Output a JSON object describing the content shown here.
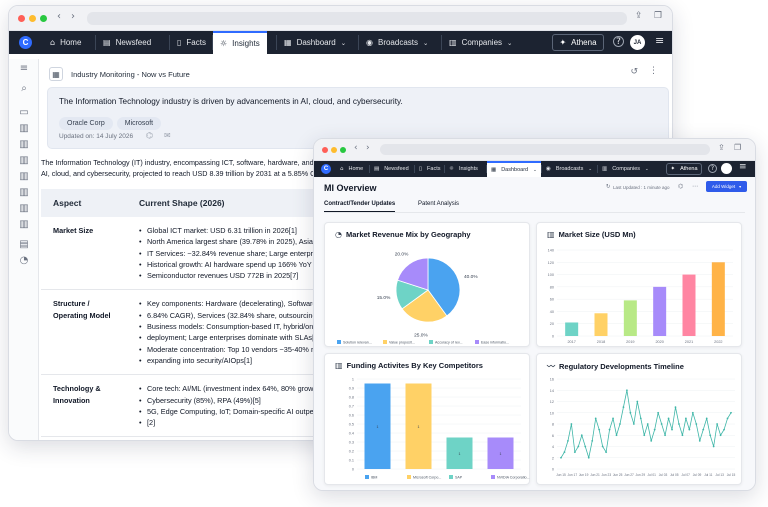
{
  "back_window": {
    "nav": {
      "logo": "C",
      "items": [
        {
          "label": "Home",
          "icon": "home-icon",
          "glyph": "⌂"
        },
        {
          "label": "Newsfeed",
          "icon": "newsfeed-icon",
          "glyph": "▤"
        },
        {
          "label": "Facts",
          "icon": "facts-icon",
          "glyph": "▯"
        },
        {
          "label": "Insights",
          "icon": "lightbulb-icon",
          "glyph": "☼",
          "active": true
        },
        {
          "label": "Dashboard",
          "icon": "dashboard-icon",
          "glyph": "▦",
          "dropdown": true
        },
        {
          "label": "Broadcasts",
          "icon": "broadcast-icon",
          "glyph": "◉",
          "dropdown": true
        },
        {
          "label": "Companies",
          "icon": "companies-icon",
          "glyph": "▥",
          "dropdown": true
        }
      ],
      "athena": "Athena",
      "avatar": "JA"
    },
    "page": {
      "title": "Industry Monitoring - Now vs Future",
      "headline": "The Information Technology industry is driven by advancements in AI, cloud, and cybersecurity.",
      "chips": [
        "Oracle Corp",
        "Microsoft"
      ],
      "updated": "Updated on: 14 July 2026",
      "intro_line1": "The Information Technology (IT) industry, encompassing ICT, software, hardware, and e",
      "intro_line2": "AI, cloud, and cybersecurity, projected to reach USD 8.39 trillion by 2031 at a 5.85% C"
    },
    "table": {
      "headers": [
        "Aspect",
        "Current Shape (2026)"
      ],
      "rows": [
        {
          "aspect": "Market Size",
          "bullets": [
            "Global ICT market: USD 6.31 trillion in 2026[1]",
            "North America largest share (39.78% in 2025), Asia-P",
            "IT Services: ~32.84% revenue share; Large enterprises",
            "Historical growth: AI hardware spend up 166% YoY Q2",
            "Semiconductor revenues USD 772B in 2025[7]"
          ]
        },
        {
          "aspect": "Structure / Operating Model",
          "bullets": [
            "Key components: Hardware (decelerating), Software (",
            "6.84% CAGR), Services (32.84% share, outsourcing)[6",
            "Business models: Consumption-based IT, hybrid/on-p",
            "deployment; Large enterprises dominate with SLAs[2",
            "Moderate concentration: Top 10 vendors ~35-40% re",
            "expanding into security/AIOps[1]"
          ]
        },
        {
          "aspect": "Technology & Innovation",
          "bullets": [
            "Core tech: AI/ML (investment index 64%, 80% growt",
            "Cybersecurity (85%), RPA (49%)[5]",
            "5G, Edge Computing, IoT; Domain-specific AI outperfo",
            "[2]"
          ]
        }
      ]
    }
  },
  "front_window": {
    "nav": {
      "logo": "C",
      "items": [
        {
          "label": "Home",
          "icon": "home-icon",
          "glyph": "⌂"
        },
        {
          "label": "Newsfeed",
          "icon": "newsfeed-icon",
          "glyph": "▤"
        },
        {
          "label": "Facts",
          "icon": "facts-icon",
          "glyph": "▯"
        },
        {
          "label": "Insights",
          "icon": "lightbulb-icon",
          "glyph": "☼"
        },
        {
          "label": "Dashboard",
          "icon": "dashboard-icon",
          "glyph": "▦",
          "dropdown": true,
          "active": true
        },
        {
          "label": "Broadcasts",
          "icon": "broadcast-icon",
          "glyph": "◉",
          "dropdown": true
        },
        {
          "label": "Companies",
          "icon": "companies-icon",
          "glyph": "▥",
          "dropdown": true
        }
      ],
      "athena": "Athena"
    },
    "overview_title": "MI Overview",
    "last_updated": "Last Updated : 1 minute ago",
    "add_widget": "Add Widget",
    "tabs": [
      "Contract/Tender Updates",
      "Patent Analysis"
    ],
    "active_tab": 0
  },
  "chart_data": [
    {
      "type": "pie",
      "title": "Market Revenue Mix by Geography",
      "labels": [
        "Solution relevan...",
        "Value proposit...",
        "Accuracy of rev...",
        "Ease informatio..."
      ],
      "values": [
        40.0,
        25.0,
        15.0,
        20.0
      ],
      "value_labels": [
        "40.0%",
        "25.0%",
        "15.0%",
        "20.0%"
      ],
      "colors": [
        "#4aa3f0",
        "#ffd166",
        "#6ed3c6",
        "#a78bfa"
      ],
      "legend": "bottom"
    },
    {
      "type": "bar",
      "title": "Market Size (USD Mn)",
      "categories": [
        "2017",
        "2018",
        "2019",
        "2020",
        "2021",
        "2022"
      ],
      "values": [
        22,
        37,
        58,
        80,
        100,
        120
      ],
      "colors": [
        "#6ed3c6",
        "#ffd166",
        "#b8e986",
        "#a78bfa",
        "#ff85a2",
        "#ffb347"
      ],
      "yticks": [
        0,
        20,
        40,
        60,
        80,
        100,
        120,
        140
      ],
      "ylim": [
        0,
        140
      ],
      "grid": true
    },
    {
      "type": "bar",
      "title": "Funding Activites By Key Competitors",
      "categories": [
        "IBM",
        "Microsoft Corpo...",
        "SAP",
        "NVIDIA Corporatio..."
      ],
      "values": [
        0.95,
        0.95,
        0.35,
        0.35
      ],
      "data_labels": [
        "1",
        "1",
        "1",
        "1"
      ],
      "colors": [
        "#4aa3f0",
        "#ffd166",
        "#6ed3c6",
        "#a78bfa"
      ],
      "yticks": [
        0,
        0.1,
        0.2,
        0.3,
        0.4,
        0.5,
        0.6,
        0.7,
        0.8,
        0.9,
        1
      ],
      "ylim": [
        0,
        1
      ],
      "legend": "bottom"
    },
    {
      "type": "line",
      "title": "Regulatory Developments Timeline",
      "x": [
        "Jun 15",
        "",
        "",
        "",
        "",
        "",
        "Jun 19",
        "",
        "",
        "",
        "",
        "",
        "Jun 23",
        "",
        "",
        "",
        "",
        "",
        "Jun 27",
        "",
        "",
        "",
        "",
        "",
        "Jul 01",
        "",
        "",
        "",
        "",
        "",
        "Jul 05",
        "",
        "",
        "",
        "",
        "",
        "Jul 09",
        "",
        "",
        "",
        "",
        "",
        "Jul 13",
        "",
        "",
        "",
        "",
        "",
        "Jul 15"
      ],
      "values": [
        2,
        3,
        5,
        8,
        3,
        4,
        6,
        4,
        2,
        5,
        9,
        7,
        4,
        3,
        7,
        9,
        6,
        8,
        11,
        14,
        10,
        8,
        12,
        9,
        6,
        8,
        5,
        7,
        10,
        8,
        6,
        9,
        7,
        11,
        8,
        6,
        9,
        7,
        10,
        8,
        5,
        7,
        9,
        6,
        4,
        8,
        6,
        7,
        9,
        10
      ],
      "xticks": [
        "Jun 15",
        "Jun 17",
        "Jun 19",
        "Jun 21",
        "Jun 23",
        "Jun 25",
        "Jun 27",
        "Jun 29",
        "Jul 01",
        "Jul 03",
        "Jul 05",
        "Jul 07",
        "Jul 09",
        "Jul 11",
        "Jul 13",
        "Jul 15"
      ],
      "yticks": [
        0,
        2,
        4,
        6,
        8,
        10,
        12,
        14,
        16
      ],
      "ylim": [
        0,
        16
      ],
      "color": "#3fb6a8",
      "grid": true
    }
  ]
}
